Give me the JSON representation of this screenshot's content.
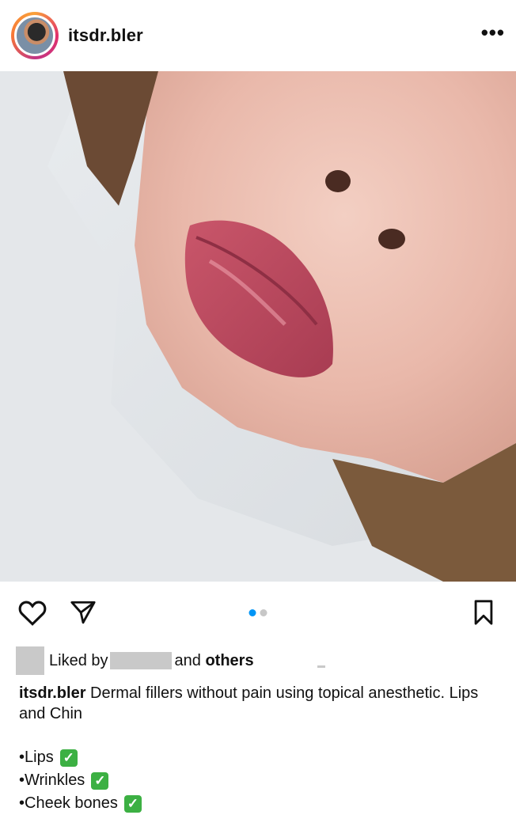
{
  "post": {
    "username": "itsdr.bler",
    "more_label": "•••",
    "image_description": "",
    "carousel": {
      "count": 2,
      "active_index": 0
    }
  },
  "likes": {
    "prefix": "Liked by",
    "middle": "and",
    "suffix": "others"
  },
  "caption": {
    "username": "itsdr.bler",
    "text": "Dermal fillers without pain using topical anesthetic. Lips and Chin",
    "list": [
      {
        "label": "•Lips",
        "check": "✓"
      },
      {
        "label": "•Wrinkles",
        "check": "✓"
      },
      {
        "label": "•Cheek bones",
        "check": "✓"
      }
    ]
  },
  "icons": [
    "heart-icon",
    "send-icon",
    "bookmark-icon",
    "more-icon"
  ],
  "colors": {
    "accent": "#0095f6",
    "check": "#3cb043",
    "redaction": "#c9c9c9"
  }
}
